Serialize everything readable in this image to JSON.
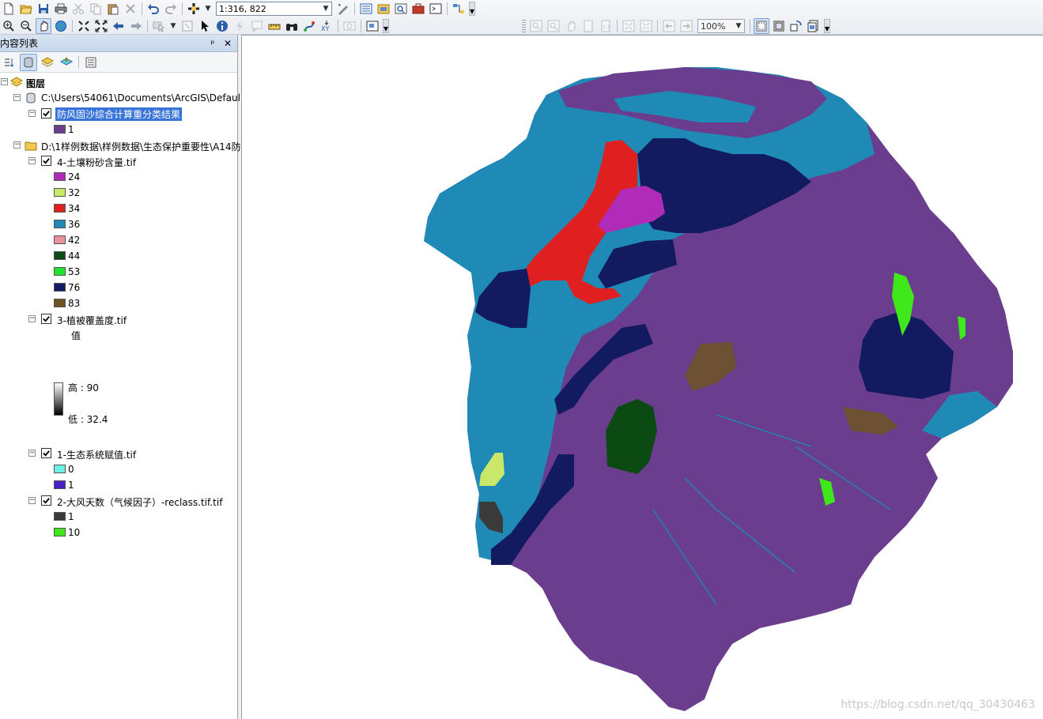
{
  "toolbar": {
    "scale": "1:316, 822",
    "zoom_percent": "100%"
  },
  "toc": {
    "title": "内容列表",
    "root_label": "图层",
    "layers": [
      {
        "path": "C:\\Users\\54061\\Documents\\ArcGIS\\Defaul",
        "name": "防风固沙综合计算重分类结果",
        "classes": [
          {
            "label": "1",
            "color": "#6a3d8f"
          }
        ]
      },
      {
        "path": "D:\\1样例数据\\样例数据\\生态保护重要性\\A14防",
        "name": "4-土壤粉砂含量.tif",
        "classes": [
          {
            "label": "24",
            "color": "#b02bb8"
          },
          {
            "label": "32",
            "color": "#c9e86a"
          },
          {
            "label": "34",
            "color": "#e02020"
          },
          {
            "label": "36",
            "color": "#1f8ab5"
          },
          {
            "label": "42",
            "color": "#e8909c"
          },
          {
            "label": "44",
            "color": "#0b4a12"
          },
          {
            "label": "53",
            "color": "#22e030"
          },
          {
            "label": "76",
            "color": "#121a60"
          },
          {
            "label": "83",
            "color": "#6e5422"
          }
        ]
      },
      {
        "name": "3-植被覆盖度.tif",
        "value_heading": "值",
        "high": "高 : 90",
        "low": "低 : 32.4"
      },
      {
        "name": "1-生态系统赋值.tif",
        "classes": [
          {
            "label": "0",
            "color": "#6ff0e6"
          },
          {
            "label": "1",
            "color": "#4a22c4"
          }
        ]
      },
      {
        "name": "2-大风天数（气候因子）-reclass.tif.tif",
        "classes": [
          {
            "label": "1",
            "color": "#3a3a3a"
          },
          {
            "label": "10",
            "color": "#3ee81a"
          }
        ]
      }
    ]
  },
  "map": {
    "colors": {
      "purple": "#6a3d8f",
      "teal": "#1f8ab5",
      "navy": "#121a60",
      "red": "#e02020",
      "magenta": "#b02bb8",
      "darkgreen": "#0b4a12",
      "brightgreen": "#3ee81a",
      "brown": "#6e5422",
      "yellowgreen": "#c9e86a",
      "gray": "#3a3a3a"
    }
  },
  "watermark": "https://blog.csdn.net/qq_30430463"
}
